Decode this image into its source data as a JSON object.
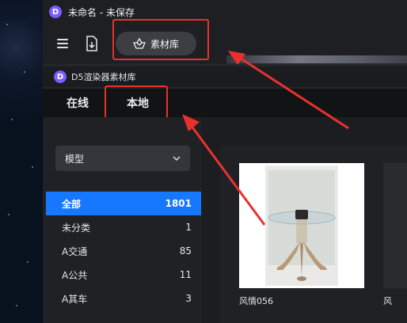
{
  "window": {
    "logo_letter": "D",
    "title": "未命名 - 未保存"
  },
  "toolbar": {
    "material_library_label": "素材库"
  },
  "library": {
    "logo_letter": "D",
    "title": "D5渲染器素材库",
    "tabs": [
      {
        "label": "在线"
      },
      {
        "label": "本地"
      }
    ],
    "dropdown_value": "模型",
    "categories": [
      {
        "name": "全部",
        "count": "1801"
      },
      {
        "name": "未分类",
        "count": "1"
      },
      {
        "name": "A交通",
        "count": "85"
      },
      {
        "name": "A公共",
        "count": "11"
      },
      {
        "name": "A其车",
        "count": "3"
      }
    ],
    "items": [
      {
        "label": "风情056"
      },
      {
        "label": "风"
      }
    ]
  },
  "colors": {
    "accent": "#1677ff",
    "highlight": "#e8312f",
    "brand": "#7b5cff"
  }
}
